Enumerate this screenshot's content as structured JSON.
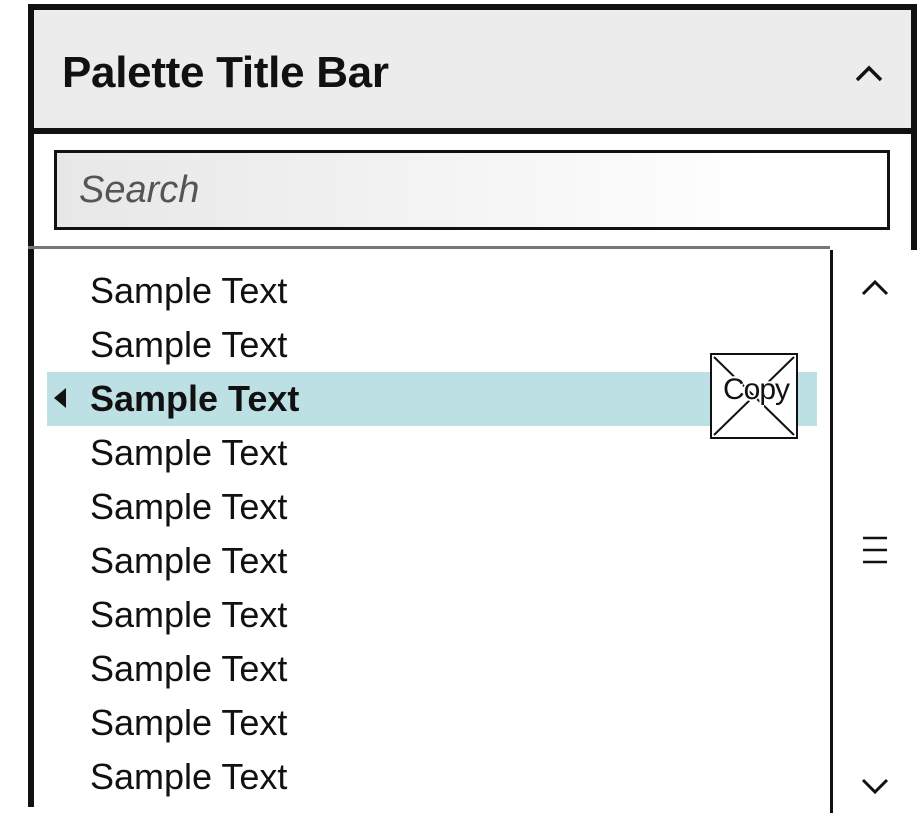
{
  "palette": {
    "title": "Palette Title Bar",
    "collapse_icon": "chevron-up-icon"
  },
  "search": {
    "placeholder": "Search",
    "value": ""
  },
  "list": {
    "items": [
      {
        "label": "Sample Text",
        "selected": false
      },
      {
        "label": "Sample Text",
        "selected": false
      },
      {
        "label": "Sample Text",
        "selected": true
      },
      {
        "label": "Sample Text",
        "selected": false
      },
      {
        "label": "Sample Text",
        "selected": false
      },
      {
        "label": "Sample Text",
        "selected": false
      },
      {
        "label": "Sample Text",
        "selected": false
      },
      {
        "label": "Sample Text",
        "selected": false
      },
      {
        "label": "Sample Text",
        "selected": false
      },
      {
        "label": "Sample Text",
        "selected": false
      }
    ],
    "selection_color": "#bde0e4",
    "selected_indicator_icon": "caret-left-icon"
  },
  "drag_feedback": {
    "label": "Copy",
    "icon": "copy-cursor-icon"
  },
  "scrollbar": {
    "up_icon": "chevron-up-icon",
    "thumb_icon": "hamburger-icon",
    "down_icon": "chevron-down-icon"
  }
}
